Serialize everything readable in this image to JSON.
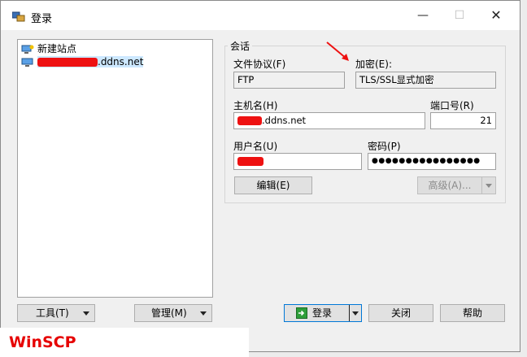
{
  "window": {
    "title": "登录"
  },
  "sites": {
    "new_site": "新建站点",
    "saved_site_suffix": ".ddns.net"
  },
  "session": {
    "group_title": "会话",
    "protocol_label": "文件协议(F)",
    "protocol_value": "FTP",
    "encryption_label": "加密(E):",
    "encryption_value": "TLS/SSL显式加密",
    "host_label": "主机名(H)",
    "host_value_suffix": ".ddns.net",
    "port_label": "端口号(R)",
    "port_value": "21",
    "user_label": "用户名(U)",
    "password_label": "密码(P)",
    "password_value": "●●●●●●●●●●●●●●●●",
    "edit_button": "编辑(E)",
    "advanced_button": "高级(A)..."
  },
  "footer": {
    "tools_button": "工具(T)",
    "manage_button": "管理(M)",
    "login_button": "登录",
    "close_button": "关闭",
    "help_button": "帮助"
  },
  "watermark": "WinSCP",
  "colors": {
    "redaction": "#ee1111",
    "annotation_arrow": "#ee1111",
    "selection": "#cde8ff",
    "login_icon": "#2e9e3a"
  }
}
